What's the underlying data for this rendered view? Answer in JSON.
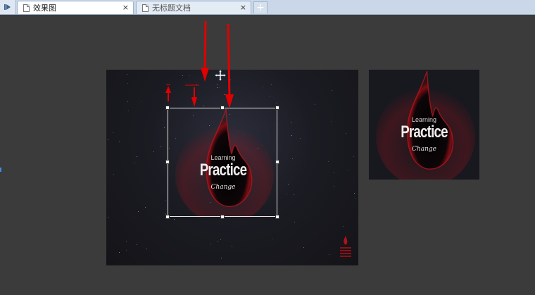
{
  "tabs": [
    {
      "label": "效果图",
      "active": true,
      "icon": "document-icon",
      "close": "×"
    },
    {
      "label": "无标题文档",
      "active": false,
      "icon": "document-icon",
      "close": "×"
    }
  ],
  "new_tab_label": "+",
  "artwork": {
    "word1": "Learning",
    "word2": "Practice",
    "word3": "Change"
  },
  "colors": {
    "tab_bar": "#c9d7e8",
    "canvas": "#3b3b3b",
    "artwork_bg": "#1a1b20",
    "drop_glow": "#b3121b",
    "annotation_arrow": "#e00000"
  }
}
